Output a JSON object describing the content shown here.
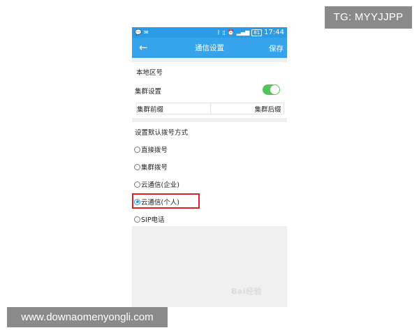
{
  "overlay": {
    "tg_label": "TG: MYYJJPP",
    "url_label": "www.downaomenyongli.com"
  },
  "status_bar": {
    "left_icons": [
      "chat-bubble-icon",
      "notification-icon"
    ],
    "right_icons": [
      "bluetooth-icon",
      "vibrate-icon",
      "alarm-icon",
      "signal-icon"
    ],
    "battery": "81",
    "time": "17:44"
  },
  "app_bar": {
    "back_glyph": "←",
    "title": "通信设置",
    "save_label": "保存",
    "color": "#35a4ec"
  },
  "settings": {
    "area_code_label": "本地区号",
    "cluster_label": "集群设置",
    "cluster_toggle_on": true,
    "cluster_prefix_label": "集群前缀",
    "cluster_suffix_label": "集群后缀"
  },
  "dial_mode": {
    "heading": "设置默认拨号方式",
    "options": [
      {
        "label": "直接拨号",
        "checked": false
      },
      {
        "label": "集群拨号",
        "checked": false
      },
      {
        "label": "云通信(企业)",
        "checked": false
      },
      {
        "label": "云通信(个人)",
        "checked": true
      },
      {
        "label": "SIP电话",
        "checked": false
      }
    ],
    "highlight_color": "#e02020"
  },
  "watermark": "Bai经验"
}
